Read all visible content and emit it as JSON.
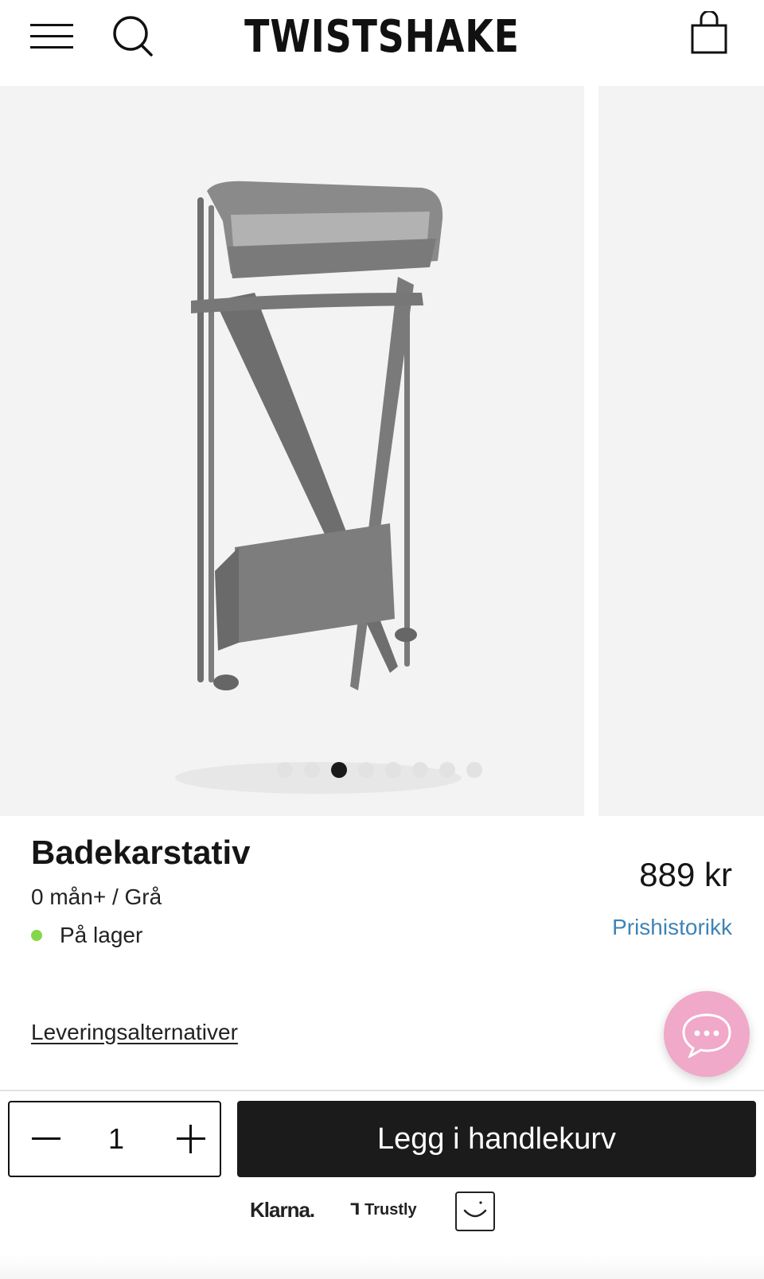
{
  "header": {
    "logo": "TWISTSHAKE",
    "menu_icon": "hamburger-menu-icon",
    "search_icon": "search-icon",
    "cart_icon": "shopping-bag-icon"
  },
  "gallery": {
    "slide_count": 8,
    "active_slide": 3,
    "image_subject": "grey folding bath stand"
  },
  "product": {
    "title": "Badekarstativ",
    "variant": "0 mån+ / Grå",
    "stock_status": "På lager",
    "stock_color": "#86d64a",
    "price": "889 kr",
    "price_history_link": "Prishistorikk",
    "delivery_link": "Leveringsalternativer"
  },
  "chat": {
    "icon": "chat-bubble-icon",
    "color": "#f0a9c8"
  },
  "purchase": {
    "quantity": "1",
    "minus_icon": "minus-icon",
    "plus_icon": "plus-icon",
    "add_to_cart_label": "Legg i handlekurv"
  },
  "payment_methods": {
    "klarna": "Klarna.",
    "trustly": "Trustly",
    "third_icon": "smile-logo-icon"
  }
}
